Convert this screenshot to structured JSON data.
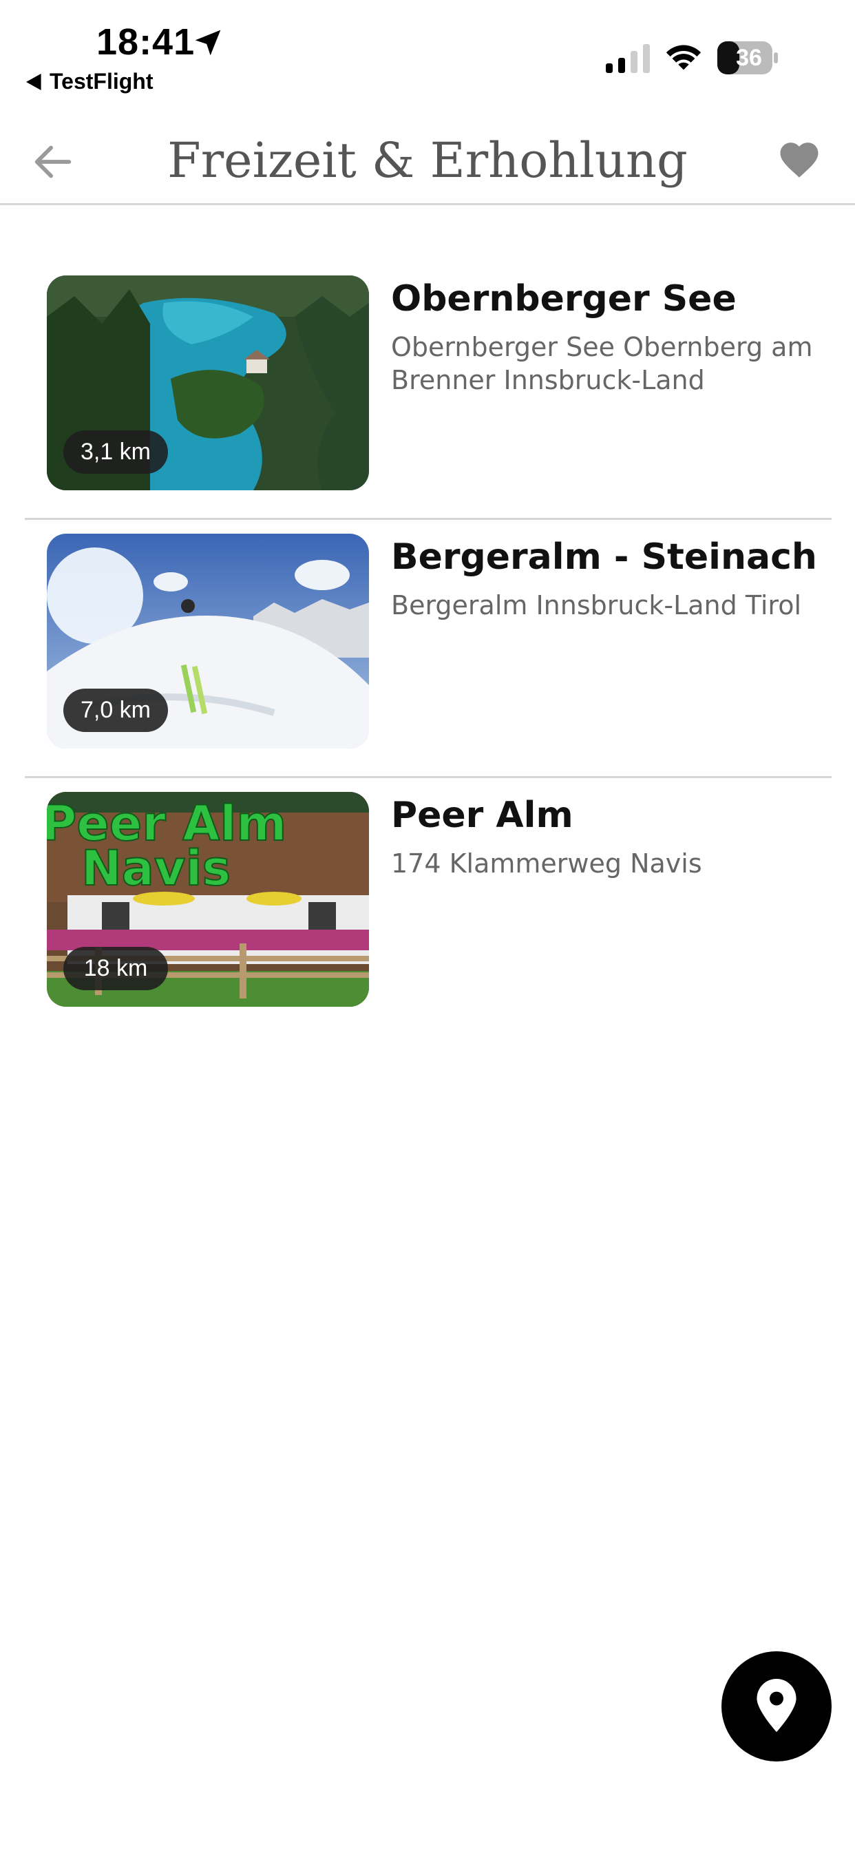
{
  "status_bar": {
    "time": "18:41",
    "back_app": "TestFlight",
    "battery": "36"
  },
  "header": {
    "title": "Freizeit & Erhohlung",
    "back_icon": "arrow-left-icon",
    "favorite_icon": "heart-icon"
  },
  "items": [
    {
      "title": "Obernberger See",
      "subtitle": "Obernberger See Obernberg am Brenner Innsbruck-Land",
      "distance": "3,1 km"
    },
    {
      "title": "Bergeralm - Steinach",
      "subtitle": "Bergeralm Innsbruck-Land Tirol",
      "distance": "7,0 km"
    },
    {
      "title": "Peer Alm",
      "subtitle": "174 Klammerweg Navis",
      "distance": "18 km",
      "image_text_line1": "Peer Alm",
      "image_text_line2": "Navis"
    }
  ],
  "map_button": {
    "icon": "map-pin-icon"
  },
  "colors": {
    "accent": "#000000",
    "header_text": "#555555",
    "subtitle": "#666666"
  }
}
